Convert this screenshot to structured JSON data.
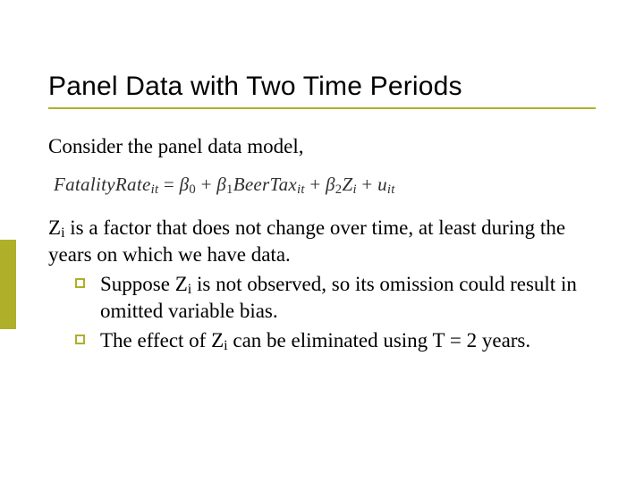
{
  "colors": {
    "accent": "#aeb02a"
  },
  "title": "Panel Data with Two Time Periods",
  "intro": "Consider the panel data model,",
  "equation": {
    "lhs_word": "FatalityRate",
    "lhs_sub": "it",
    "eq": " = ",
    "b0": "β",
    "b0_sub": "0",
    "plus1": " + ",
    "b1": "β",
    "b1_sub": "1",
    "term1": "BeerTax",
    "term1_sub": "it",
    "plus2": " + ",
    "b2": "β",
    "b2_sub": "2",
    "term2": "Z",
    "term2_sub": "i",
    "plus3": " + ",
    "u": "u",
    "u_sub": "it"
  },
  "zpara": {
    "part1": "Z",
    "sub1": "i",
    "part2": " is a factor that does not change over time, at least during the years on which we have data."
  },
  "bullets": [
    {
      "p1": "Suppose Z",
      "s1": "i",
      "p2": " is not observed, so its omission could result in omitted variable bias."
    },
    {
      "p1": "The effect of Z",
      "s1": "i",
      "p2": " can be eliminated using T = 2 years."
    }
  ]
}
